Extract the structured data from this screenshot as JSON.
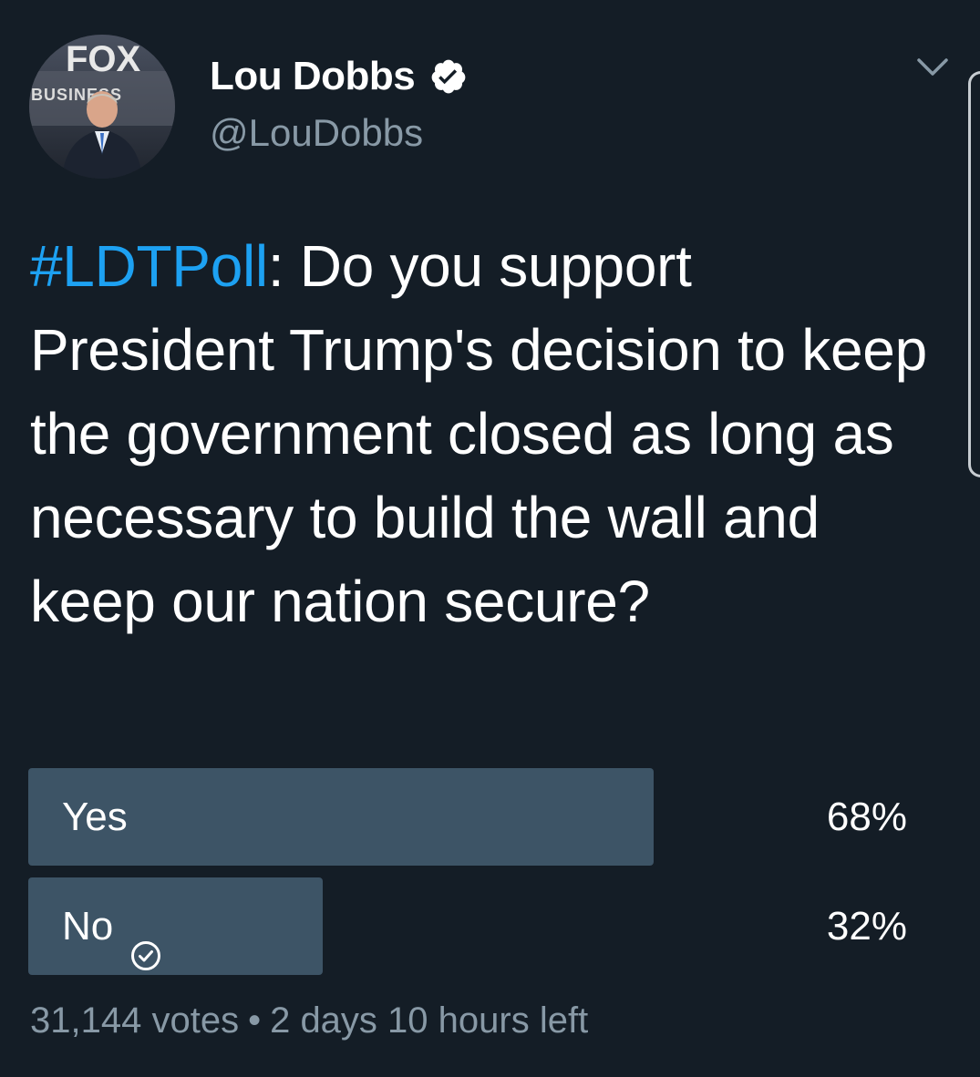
{
  "author": {
    "display_name": "Lou Dobbs",
    "handle": "@LouDobbs",
    "verified": true,
    "avatar_logo_text": "FOX BUSINESS"
  },
  "tweet": {
    "hashtag": "#LDTPoll",
    "text": ": Do you support President Trump's decision to keep the government closed as long as necessary to build the wall and keep our nation secure?"
  },
  "poll": {
    "options": [
      {
        "label": "Yes",
        "percent": "68%",
        "fraction": 0.68,
        "voted": false
      },
      {
        "label": "No",
        "percent": "32%",
        "fraction": 0.32,
        "voted": true
      }
    ],
    "votes": "31,144 votes",
    "separator": "•",
    "time_left": "2 days 10 hours left"
  },
  "icons": {
    "verified": "verified-badge-icon",
    "caret": "chevron-down-icon",
    "vote_check": "check-circle-icon"
  },
  "colors": {
    "background": "#141d26",
    "accent": "#1da1f2",
    "muted": "#8899a6",
    "poll_bar": "#3d5466"
  }
}
